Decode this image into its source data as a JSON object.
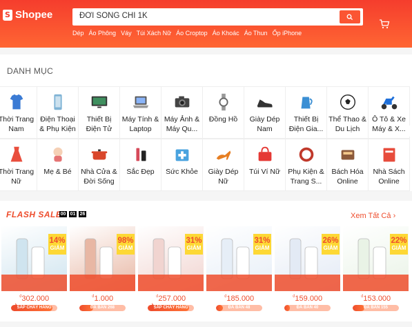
{
  "header": {
    "logo_glyph": "S",
    "logo_text": "Shopee",
    "search_value": "ĐỜI SỐNG CHỈ 1K",
    "keywords": [
      "Dép",
      "Áo Phông",
      "Váy",
      "Túi Xách Nữ",
      "Áo Croptop",
      "Áo Khoác",
      "Áo Thun",
      "Ốp iPhone"
    ]
  },
  "categories": {
    "title": "DANH MỤC",
    "items": [
      {
        "label": "Thời Trang Nam",
        "icon": "shirt-icon",
        "color": "#3b7bd4"
      },
      {
        "label": "Điện Thoại & Phụ Kiện",
        "icon": "phone-icon",
        "color": "#7fb3d5"
      },
      {
        "label": "Thiết Bị Điện Tử",
        "icon": "tv-icon",
        "color": "#3f8f5f"
      },
      {
        "label": "Máy Tính & Laptop",
        "icon": "laptop-icon",
        "color": "#555"
      },
      {
        "label": "Máy Ảnh & Máy Qu...",
        "icon": "camera-icon",
        "color": "#444"
      },
      {
        "label": "Đồng Hồ",
        "icon": "watch-icon",
        "color": "#666"
      },
      {
        "label": "Giày Dép Nam",
        "icon": "shoe-icon",
        "color": "#333"
      },
      {
        "label": "Thiết Bị Điện Gia...",
        "icon": "kettle-icon",
        "color": "#3b8fd4"
      },
      {
        "label": "Thể Thao & Du Lịch",
        "icon": "ball-icon",
        "color": "#222"
      },
      {
        "label": "Ô Tô & Xe Máy & X...",
        "icon": "scooter-icon",
        "color": "#1e6fd9"
      },
      {
        "label": "Thời Trang Nữ",
        "icon": "dress-icon",
        "color": "#e94e3d"
      },
      {
        "label": "Mẹ & Bé",
        "icon": "baby-icon",
        "color": "#e57373"
      },
      {
        "label": "Nhà Cửa & Đời Sống",
        "icon": "pot-icon",
        "color": "#d9472b"
      },
      {
        "label": "Sắc Đẹp",
        "icon": "cosmetics-icon",
        "color": "#d64a5a"
      },
      {
        "label": "Sức Khỏe",
        "icon": "health-icon",
        "color": "#4aa3df"
      },
      {
        "label": "Giày Dép Nữ",
        "icon": "heel-icon",
        "color": "#e67e22"
      },
      {
        "label": "Túi Ví Nữ",
        "icon": "handbag-icon",
        "color": "#e53935"
      },
      {
        "label": "Phụ Kiện & Trang S...",
        "icon": "bracelet-icon",
        "color": "#c0392b"
      },
      {
        "label": "Bách Hóa Online",
        "icon": "grocery-icon",
        "color": "#8d5a3b"
      },
      {
        "label": "Nhà Sách Online",
        "icon": "book-icon",
        "color": "#e74c3c"
      }
    ]
  },
  "flash_sale": {
    "title": "FLASH SALE",
    "timer": [
      "00",
      "01",
      "26"
    ],
    "see_all": "Xem Tất Cả",
    "products": [
      {
        "discount": "14%",
        "off_label": "GIẢM",
        "currency": "₫",
        "price": "302.000",
        "sold_label": "SẮP CHÁY HÀNG",
        "progress": 0.9,
        "hot": true,
        "img_color": "#cfe4ef"
      },
      {
        "discount": "98%",
        "off_label": "GIẢM",
        "currency": "₫",
        "price": "1.000",
        "sold_label": "ĐÃ BÁN 268",
        "progress": 0.3,
        "hot": false,
        "img_color": "#e8b7a4"
      },
      {
        "discount": "31%",
        "off_label": "GIẢM",
        "currency": "₫",
        "price": "257.000",
        "sold_label": "SẮP CHÁY HÀNG",
        "progress": 0.9,
        "hot": true,
        "img_color": "#f1d4d0"
      },
      {
        "discount": "31%",
        "off_label": "GIẢM",
        "currency": "₫",
        "price": "185.000",
        "sold_label": "ĐÃ BÁN 48",
        "progress": 0.15,
        "hot": false,
        "img_color": "#e6eef7"
      },
      {
        "discount": "26%",
        "off_label": "GIẢM",
        "currency": "₫",
        "price": "159.000",
        "sold_label": "ĐÃ BÁN 40",
        "progress": 0.12,
        "hot": false,
        "img_color": "#e3eaf5"
      },
      {
        "discount": "22%",
        "off_label": "GIẢM",
        "currency": "₫",
        "price": "153.000",
        "sold_label": "ĐÃ BÁN 155",
        "progress": 0.25,
        "hot": false,
        "img_color": "#e9f3e6"
      }
    ]
  }
}
